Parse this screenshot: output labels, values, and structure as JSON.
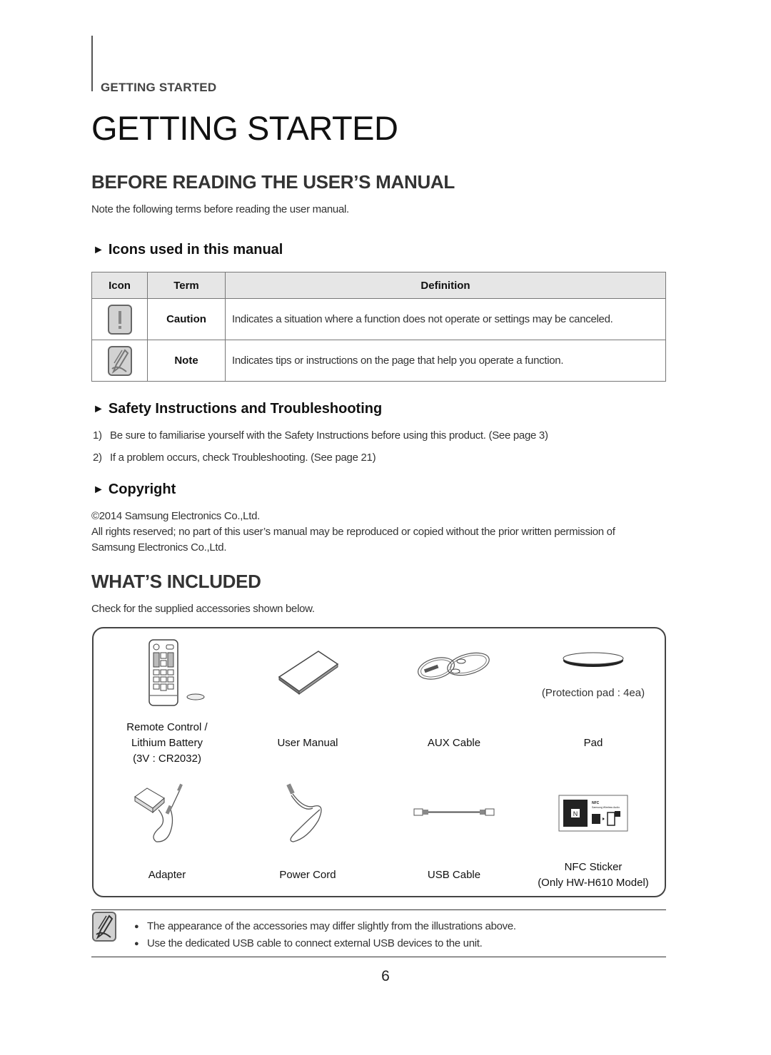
{
  "header": {
    "section_label": "GETTING STARTED",
    "page_title": "GETTING STARTED"
  },
  "before_reading": {
    "heading": "BEFORE READING THE USER’S MANUAL",
    "intro": "Note the following terms before reading the user manual.",
    "icons_section": {
      "heading": "Icons used in this manual",
      "bullet_icon": "triangle-right-icon",
      "columns": [
        "Icon",
        "Term",
        "Definition"
      ],
      "rows": [
        {
          "icon": "caution-icon",
          "term": "Caution",
          "definition": "Indicates a situation where a function does not operate or settings may be canceled."
        },
        {
          "icon": "note-icon",
          "term": "Note",
          "definition": "Indicates tips or instructions on the page that help you operate a function."
        }
      ]
    },
    "safety_section": {
      "heading": "Safety Instructions and Troubleshooting",
      "items": [
        {
          "num": "1)",
          "text": "Be sure to familiarise yourself with the Safety Instructions before using this product. (See page 3)"
        },
        {
          "num": "2)",
          "text": "If a problem occurs, check Troubleshooting. (See page 21)"
        }
      ]
    },
    "copyright_section": {
      "heading": "Copyright",
      "line1": "©2014 Samsung Electronics Co.,Ltd.",
      "line2": "All rights reserved; no part of this user’s manual may be reproduced or copied without the prior written permission of",
      "line3": "Samsung Electronics Co.,Ltd."
    }
  },
  "whats_included": {
    "heading": "WHAT’S INCLUDED",
    "intro": "Check for the supplied accessories shown below.",
    "items": [
      {
        "icon": "remote-control-icon",
        "label_lines": [
          "Remote Control /",
          "Lithium Battery",
          "(3V : CR2032)"
        ]
      },
      {
        "icon": "user-manual-icon",
        "label_lines": [
          "User Manual"
        ]
      },
      {
        "icon": "aux-cable-icon",
        "label_lines": [
          "AUX Cable"
        ]
      },
      {
        "icon": "pad-icon",
        "caption": "(Protection pad : 4ea)",
        "label_lines": [
          "Pad"
        ]
      },
      {
        "icon": "adapter-icon",
        "label_lines": [
          "Adapter"
        ]
      },
      {
        "icon": "power-cord-icon",
        "label_lines": [
          "Power Cord"
        ]
      },
      {
        "icon": "usb-cable-icon",
        "label_lines": [
          "USB Cable"
        ]
      },
      {
        "icon": "nfc-sticker-icon",
        "label_lines": [
          "NFC Sticker",
          "(Only HW-H610 Model)"
        ],
        "sticker_text": {
          "title": "NFC",
          "subtitle": "Samsung Wireless Audio"
        }
      }
    ],
    "notes": [
      "The appearance of the accessories may differ slightly from the illustrations above.",
      "Use the dedicated USB cable to connect external USB devices to the unit."
    ]
  },
  "footer": {
    "page_number": "6"
  }
}
